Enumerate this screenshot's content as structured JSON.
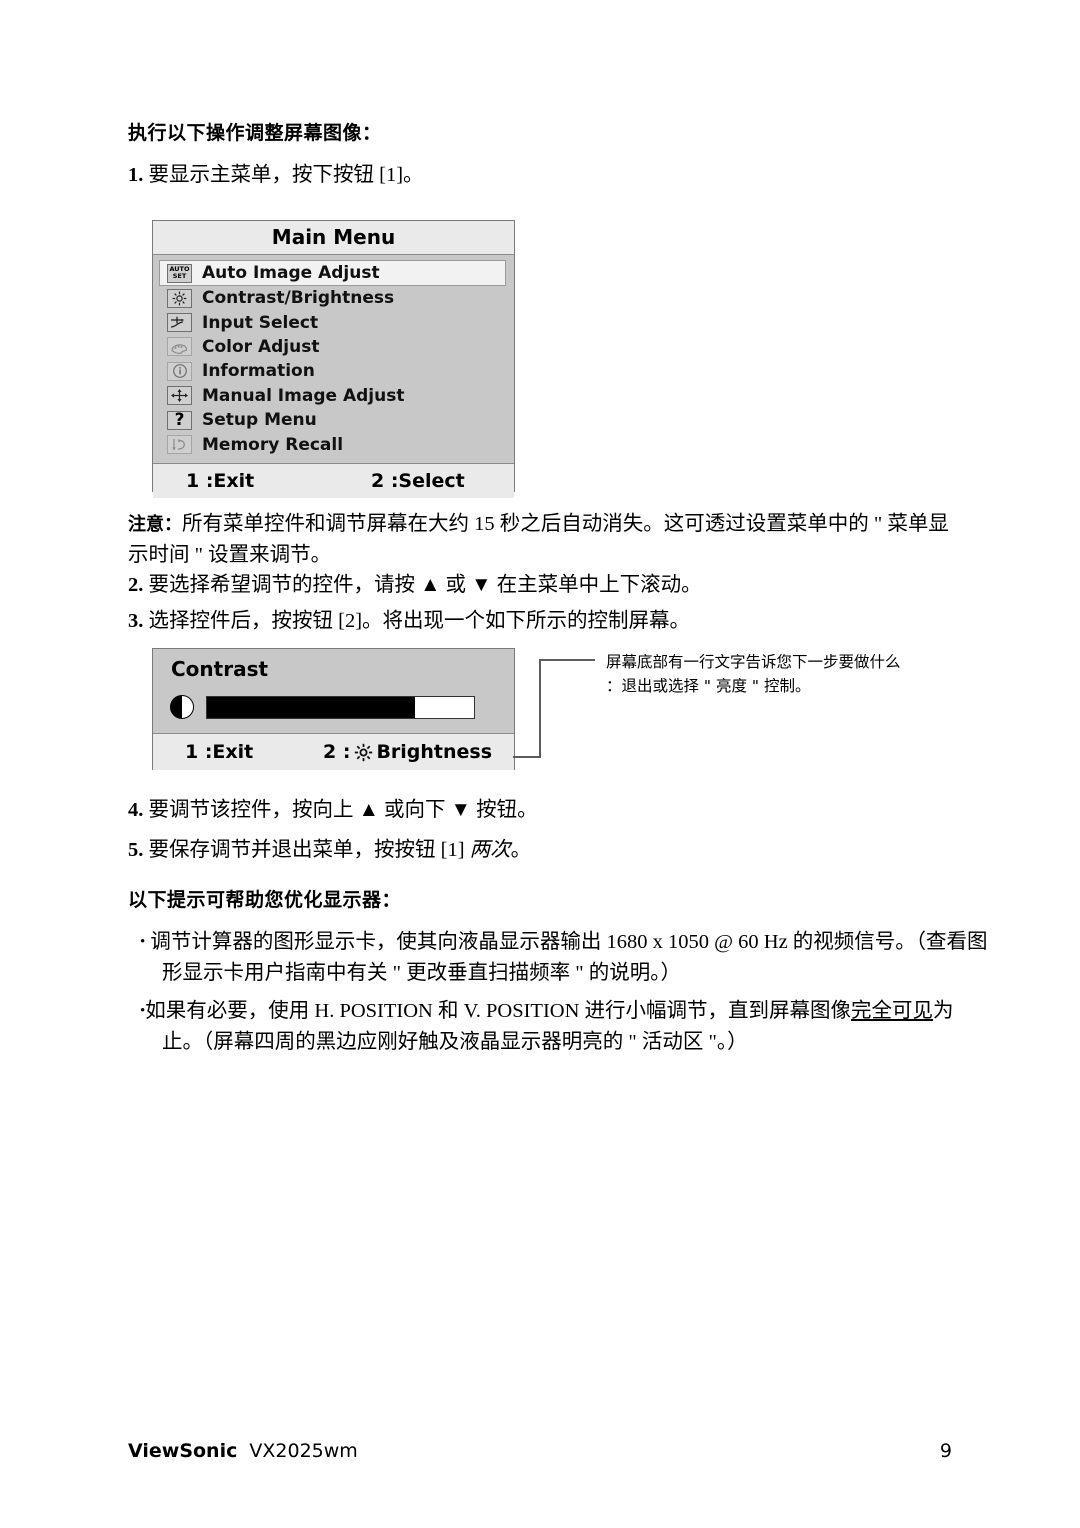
{
  "section_heading": "执行以下操作调整屏幕图像：",
  "steps": {
    "s1_num": "1.",
    "s1_text": "要显示主菜单，按下按钮 [1]。",
    "s2_num": "2.",
    "s2_text": "要选择希望调节的控件，请按 ▲ 或 ▼ 在主菜单中上下滚动。",
    "s3_num": "3.",
    "s3_text": "选择控件后，按按钮 [2]。将出现一个如下所示的控制屏幕。",
    "s4_num": "4.",
    "s4_text": "要调节该控件，按向上 ▲ 或向下 ▼ 按钮。",
    "s5_num": "5.",
    "s5_text_a": "要保存调节并退出菜单，按按钮 [1] ",
    "s5_text_b": "两次",
    "s5_text_c": "。"
  },
  "note": {
    "label": "注意：",
    "text": "所有菜单控件和调节屏幕在大约 15 秒之后自动消失。这可透过设置菜单中的 \" 菜单显示时间 \" 设置来调节。"
  },
  "main_menu": {
    "title": "Main Menu",
    "items": [
      {
        "icon": "auto-set-icon",
        "label": "Auto Image Adjust",
        "selected": true
      },
      {
        "icon": "brightness-sun-icon",
        "label": "Contrast/Brightness",
        "selected": false
      },
      {
        "icon": "input-select-icon",
        "label": "Input Select",
        "selected": false
      },
      {
        "icon": "color-palette-icon",
        "label": "Color Adjust",
        "selected": false
      },
      {
        "icon": "information-icon",
        "label": "Information",
        "selected": false
      },
      {
        "icon": "manual-image-adjust-icon",
        "label": "Manual Image Adjust",
        "selected": false
      },
      {
        "icon": "question-mark-icon",
        "label": "Setup Menu",
        "selected": false
      },
      {
        "icon": "memory-recall-icon",
        "label": "Memory Recall",
        "selected": false
      }
    ],
    "footer_left": "1 :Exit",
    "footer_right": "2 :Select",
    "icon_auto_line1": "AUTO",
    "icon_auto_line2": "SET",
    "icon_question": "?"
  },
  "contrast_panel": {
    "title": "Contrast",
    "slider_fill_percent": 78,
    "footer_left": "1 :Exit",
    "footer_right_prefix": "2 :",
    "footer_right_label": "Brightness"
  },
  "callout": {
    "line1": "屏幕底部有一行文字告诉您下一步要做什么",
    "line2": "：退出或选择 \" 亮度 \" 控制。"
  },
  "tips_heading": "以下提示可帮助您优化显示器：",
  "tips": [
    {
      "pre": "调节计算器的图形显示卡，使其向液晶显示器输出 1680 x 1050 @ 60 Hz 的视频信号。（查看图形显示卡用户指南中有关 \" 更改垂直扫描频率 \" 的说明。）"
    },
    {
      "pre": "如果有必要，使用 H. POSITION 和 V. POSITION 进行小幅调节，直到屏幕图像",
      "underline": "完全可见",
      "post": "为止。（屏幕四周的黑边应刚好触及液晶显示器明亮的 \" 活动区 \"。）"
    }
  ],
  "footer": {
    "brand": "ViewSonic",
    "model": "VX2025wm",
    "page": "9"
  },
  "colors": {
    "osd_body": "#c8c8c8",
    "osd_bar": "#eaeaea",
    "osd_border": "#7a7a7a",
    "selected_row": "#f2f2f2"
  }
}
